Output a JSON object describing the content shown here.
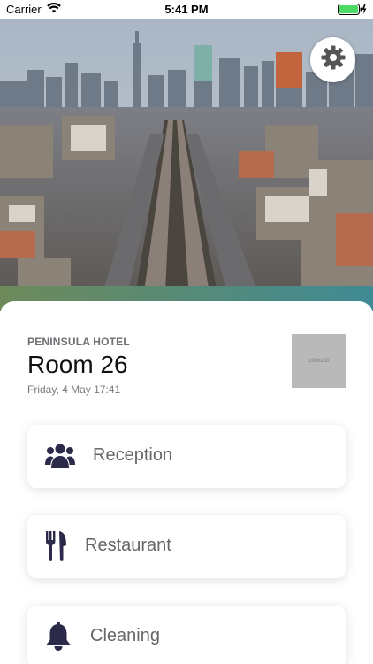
{
  "status_bar": {
    "carrier": "Carrier",
    "time": "5:41 PM"
  },
  "header": {
    "hero_image": "city-skyline-railway-photo",
    "settings_icon": "gear-icon"
  },
  "hotel": {
    "name": "PENINSULA HOTEL",
    "room": "Room 26",
    "datetime": "Friday, 4 May 17:41",
    "thumbnail_text": "100x100"
  },
  "menu": [
    {
      "label": "Reception",
      "icon": "people-group-icon"
    },
    {
      "label": "Restaurant",
      "icon": "fork-knife-icon"
    },
    {
      "label": "Cleaning",
      "icon": "bell-icon"
    }
  ],
  "colors": {
    "icon": "#2c2a4a",
    "label": "#66666b",
    "accent_gradient_left": "#6e8a5a",
    "accent_gradient_right": "#3f8a94",
    "battery": "#4cd964"
  }
}
